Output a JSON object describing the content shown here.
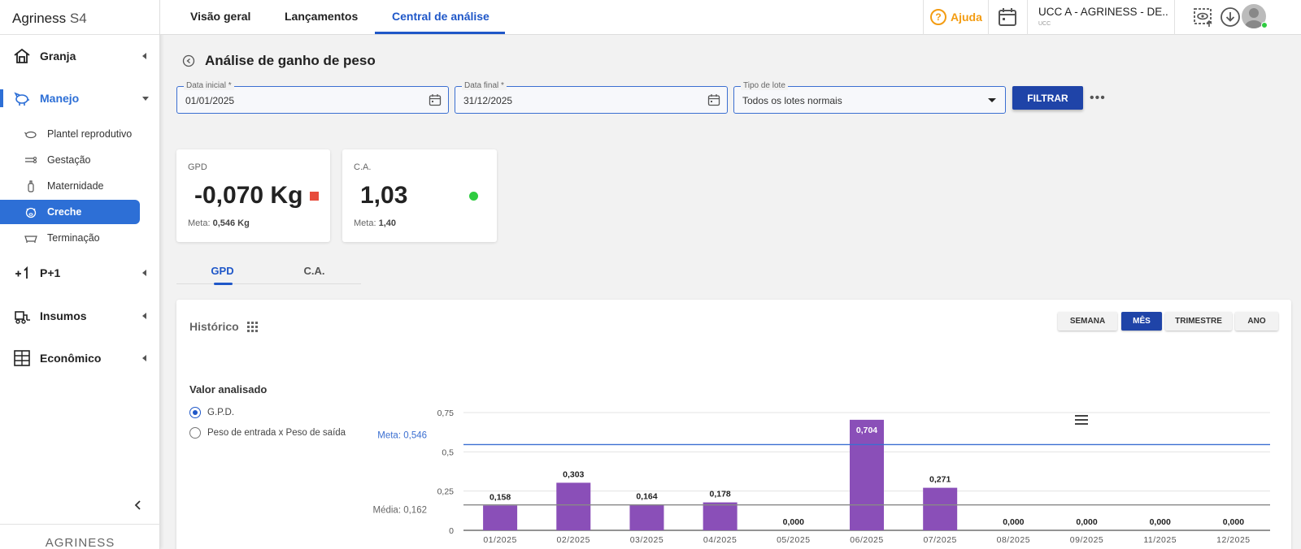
{
  "app": {
    "name": "Agriness",
    "version": "S4",
    "footer_logo": "AGRINESS"
  },
  "sidebar": {
    "groups": [
      {
        "label": "Granja"
      },
      {
        "label": "Manejo"
      },
      {
        "label": "P+1"
      },
      {
        "label": "Insumos"
      },
      {
        "label": "Econômico"
      }
    ],
    "manejo_items": [
      {
        "label": "Plantel reprodutivo"
      },
      {
        "label": "Gestação"
      },
      {
        "label": "Maternidade"
      },
      {
        "label": "Creche"
      },
      {
        "label": "Terminação"
      }
    ]
  },
  "topbar": {
    "tabs": [
      {
        "label": "Visão geral"
      },
      {
        "label": "Lançamentos"
      },
      {
        "label": "Central de análise"
      }
    ],
    "help_label": "Ajuda",
    "unit_name": "UCC A - AGRINESS - DE...",
    "unit_type": "UCC"
  },
  "page": {
    "title": "Análise de ganho de peso"
  },
  "filters": {
    "start_label": "Data inicial *",
    "start_value": "01/01/2025",
    "end_label": "Data final *",
    "end_value": "31/12/2025",
    "lot_label": "Tipo de lote",
    "lot_value": "Todos os lotes normais",
    "filter_button": "FILTRAR",
    "more": "•••"
  },
  "kpis": [
    {
      "label": "GPD",
      "value": "-0,070 Kg",
      "meta_label": "Meta:",
      "meta_value": "0,546 Kg",
      "status_color": "#e74c3c"
    },
    {
      "label": "C.A.",
      "value": "1,03",
      "meta_label": "Meta:",
      "meta_value": "1,40",
      "status_color": "#2ecc40"
    }
  ],
  "subtabs": [
    {
      "label": "GPD"
    },
    {
      "label": "C.A."
    }
  ],
  "history": {
    "title": "Histórico",
    "periods": [
      {
        "label": "SEMANA"
      },
      {
        "label": "MÊS"
      },
      {
        "label": "TRIMESTRE"
      },
      {
        "label": "ANO"
      }
    ],
    "selected_period": "MÊS",
    "value_title": "Valor analisado",
    "options": [
      {
        "label": "G.P.D."
      },
      {
        "label": "Peso de entrada x Peso de saída"
      }
    ]
  },
  "chart_data": {
    "type": "bar",
    "categories": [
      "01/2025",
      "02/2025",
      "03/2025",
      "04/2025",
      "05/2025",
      "06/2025",
      "07/2025",
      "08/2025",
      "09/2025",
      "11/2025",
      "12/2025"
    ],
    "values": [
      0.158,
      0.303,
      0.164,
      0.178,
      0.0,
      0.704,
      0.271,
      0.0,
      0.0,
      0.0,
      0.0
    ],
    "data_labels": [
      "0,158",
      "0,303",
      "0,164",
      "0,178",
      "0,000",
      "0,704",
      "0,271",
      "0,000",
      "0,000",
      "0,000",
      "0,000"
    ],
    "y_ticks": [
      "0",
      "0,25",
      "0,5",
      "0,75"
    ],
    "y_tick_values": [
      0,
      0.25,
      0.5,
      0.75
    ],
    "ylim": [
      0,
      0.75
    ],
    "bar_color": "#8a4fb8",
    "reference_lines": [
      {
        "label": "Meta: 0,546",
        "value": 0.546,
        "color": "#3b6fd1"
      },
      {
        "label": "Média: 0,162",
        "value": 0.162,
        "color": "#888888"
      }
    ]
  }
}
